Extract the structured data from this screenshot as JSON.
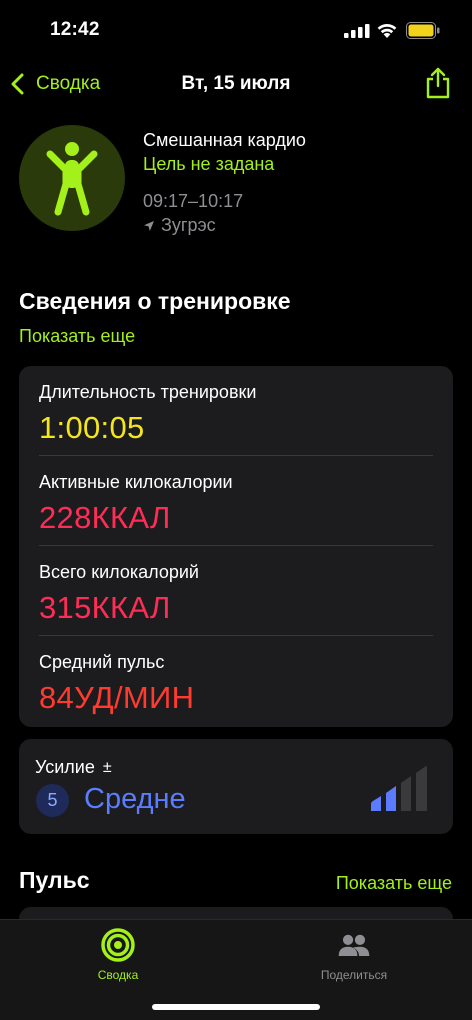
{
  "status_bar": {
    "time": "12:42",
    "icons": [
      "signal-icon",
      "wifi-icon",
      "battery-icon"
    ],
    "battery_color": "#f2d21b"
  },
  "nav": {
    "back_label": "Сводка",
    "title": "Вт, 15 июля",
    "share_icon": "share-icon"
  },
  "workout": {
    "icon": "figure-cardio-icon",
    "name": "Смешанная кардио",
    "goal": "Цель не задана",
    "time_range": "09:17–10:17",
    "location": "Зугрэс"
  },
  "details": {
    "title": "Сведения о тренировке",
    "show_more": "Показать еще",
    "stats": [
      {
        "label": "Длительность тренировки",
        "value": "1:00:05",
        "color": "#f5e51b"
      },
      {
        "label": "Активные килокалории",
        "value": "228ККАЛ",
        "color": "#ff2d55"
      },
      {
        "label": "Всего килокалорий",
        "value": "315ККАЛ",
        "color": "#ff2d55"
      },
      {
        "label": "Средний пульс",
        "value": "84УД/МИН",
        "color": "#ff3b30"
      }
    ]
  },
  "effort": {
    "label": "Усилие",
    "adjust_symbol": "±",
    "score": "5",
    "level": "Средне",
    "level_color": "#5b7cff"
  },
  "heart_rate": {
    "title": "Пульс",
    "show_more": "Показать еще"
  },
  "tab_bar": {
    "tabs": [
      {
        "label": "Сводка",
        "icon": "activity-rings-icon",
        "active": true,
        "color": "#a3f01a"
      },
      {
        "label": "Поделиться",
        "icon": "people-icon",
        "active": false,
        "color": "#8e8e93"
      }
    ]
  },
  "colors": {
    "accent": "#a3f01a",
    "card_bg": "#1c1c1e",
    "secondary_text": "#8e8e93"
  }
}
